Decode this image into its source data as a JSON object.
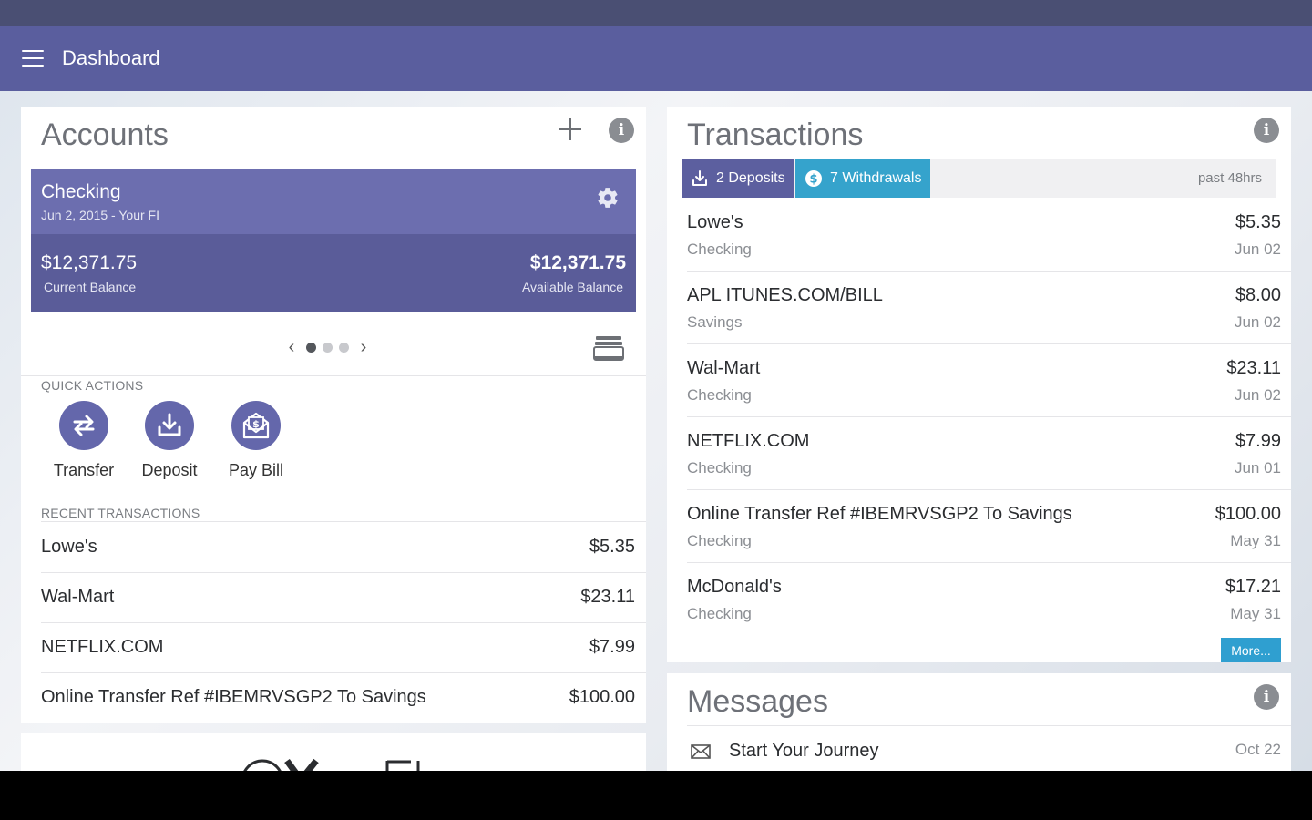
{
  "app": {
    "title": "Dashboard"
  },
  "accounts": {
    "title": "Accounts",
    "card": {
      "name": "Checking",
      "subtitle": "Jun 2, 2015  - Your FI",
      "current_balance": "$12,371.75",
      "current_label": "Current Balance",
      "available_balance": "$12,371.75",
      "available_label": "Available Balance"
    },
    "pager": {
      "total": 3,
      "active": 0
    },
    "quick_actions_label": "QUICK ACTIONS",
    "quick_actions": [
      {
        "label": "Transfer",
        "icon": "transfer-icon"
      },
      {
        "label": "Deposit",
        "icon": "deposit-icon"
      },
      {
        "label": "Pay Bill",
        "icon": "pay-bill-icon"
      }
    ],
    "recent_label": "RECENT TRANSACTIONS",
    "recent": [
      {
        "name": "Lowe's",
        "amount": "$5.35"
      },
      {
        "name": "Wal-Mart",
        "amount": "$23.11"
      },
      {
        "name": "NETFLIX.COM",
        "amount": "$7.99"
      },
      {
        "name": "Online Transfer Ref #IBEMRVSGP2 To Savings",
        "amount": "$100.00"
      }
    ]
  },
  "transactions": {
    "title": "Transactions",
    "tab_deposits": "2 Deposits",
    "tab_withdrawals": "7 Withdrawals",
    "period": "past 48hrs",
    "items": [
      {
        "name": "Lowe's",
        "account": "Checking",
        "amount": "$5.35",
        "date": "Jun 02"
      },
      {
        "name": "APL ITUNES.COM/BILL",
        "account": "Savings",
        "amount": "$8.00",
        "date": "Jun 02"
      },
      {
        "name": "Wal-Mart",
        "account": "Checking",
        "amount": "$23.11",
        "date": "Jun 02"
      },
      {
        "name": "NETFLIX.COM",
        "account": "Checking",
        "amount": "$7.99",
        "date": "Jun 01"
      },
      {
        "name": "Online Transfer Ref #IBEMRVSGP2 To Savings",
        "account": "Checking",
        "amount": "$100.00",
        "date": "May 31"
      },
      {
        "name": "McDonald's",
        "account": "Checking",
        "amount": "$17.21",
        "date": "May 31"
      }
    ],
    "more_label": "More..."
  },
  "messages": {
    "title": "Messages",
    "items": [
      {
        "subject": "Start Your Journey",
        "date": "Oct 22"
      }
    ]
  },
  "colors": {
    "appbar": "#5a5e9e",
    "statusbar": "#4a4f73",
    "account_card_top": "#6c6eaf",
    "account_card_bottom": "#5a5c99",
    "deposits_tab": "#5c5f9f",
    "withdrawals_tab": "#35a3cc",
    "more_button": "#2f9fd0"
  }
}
